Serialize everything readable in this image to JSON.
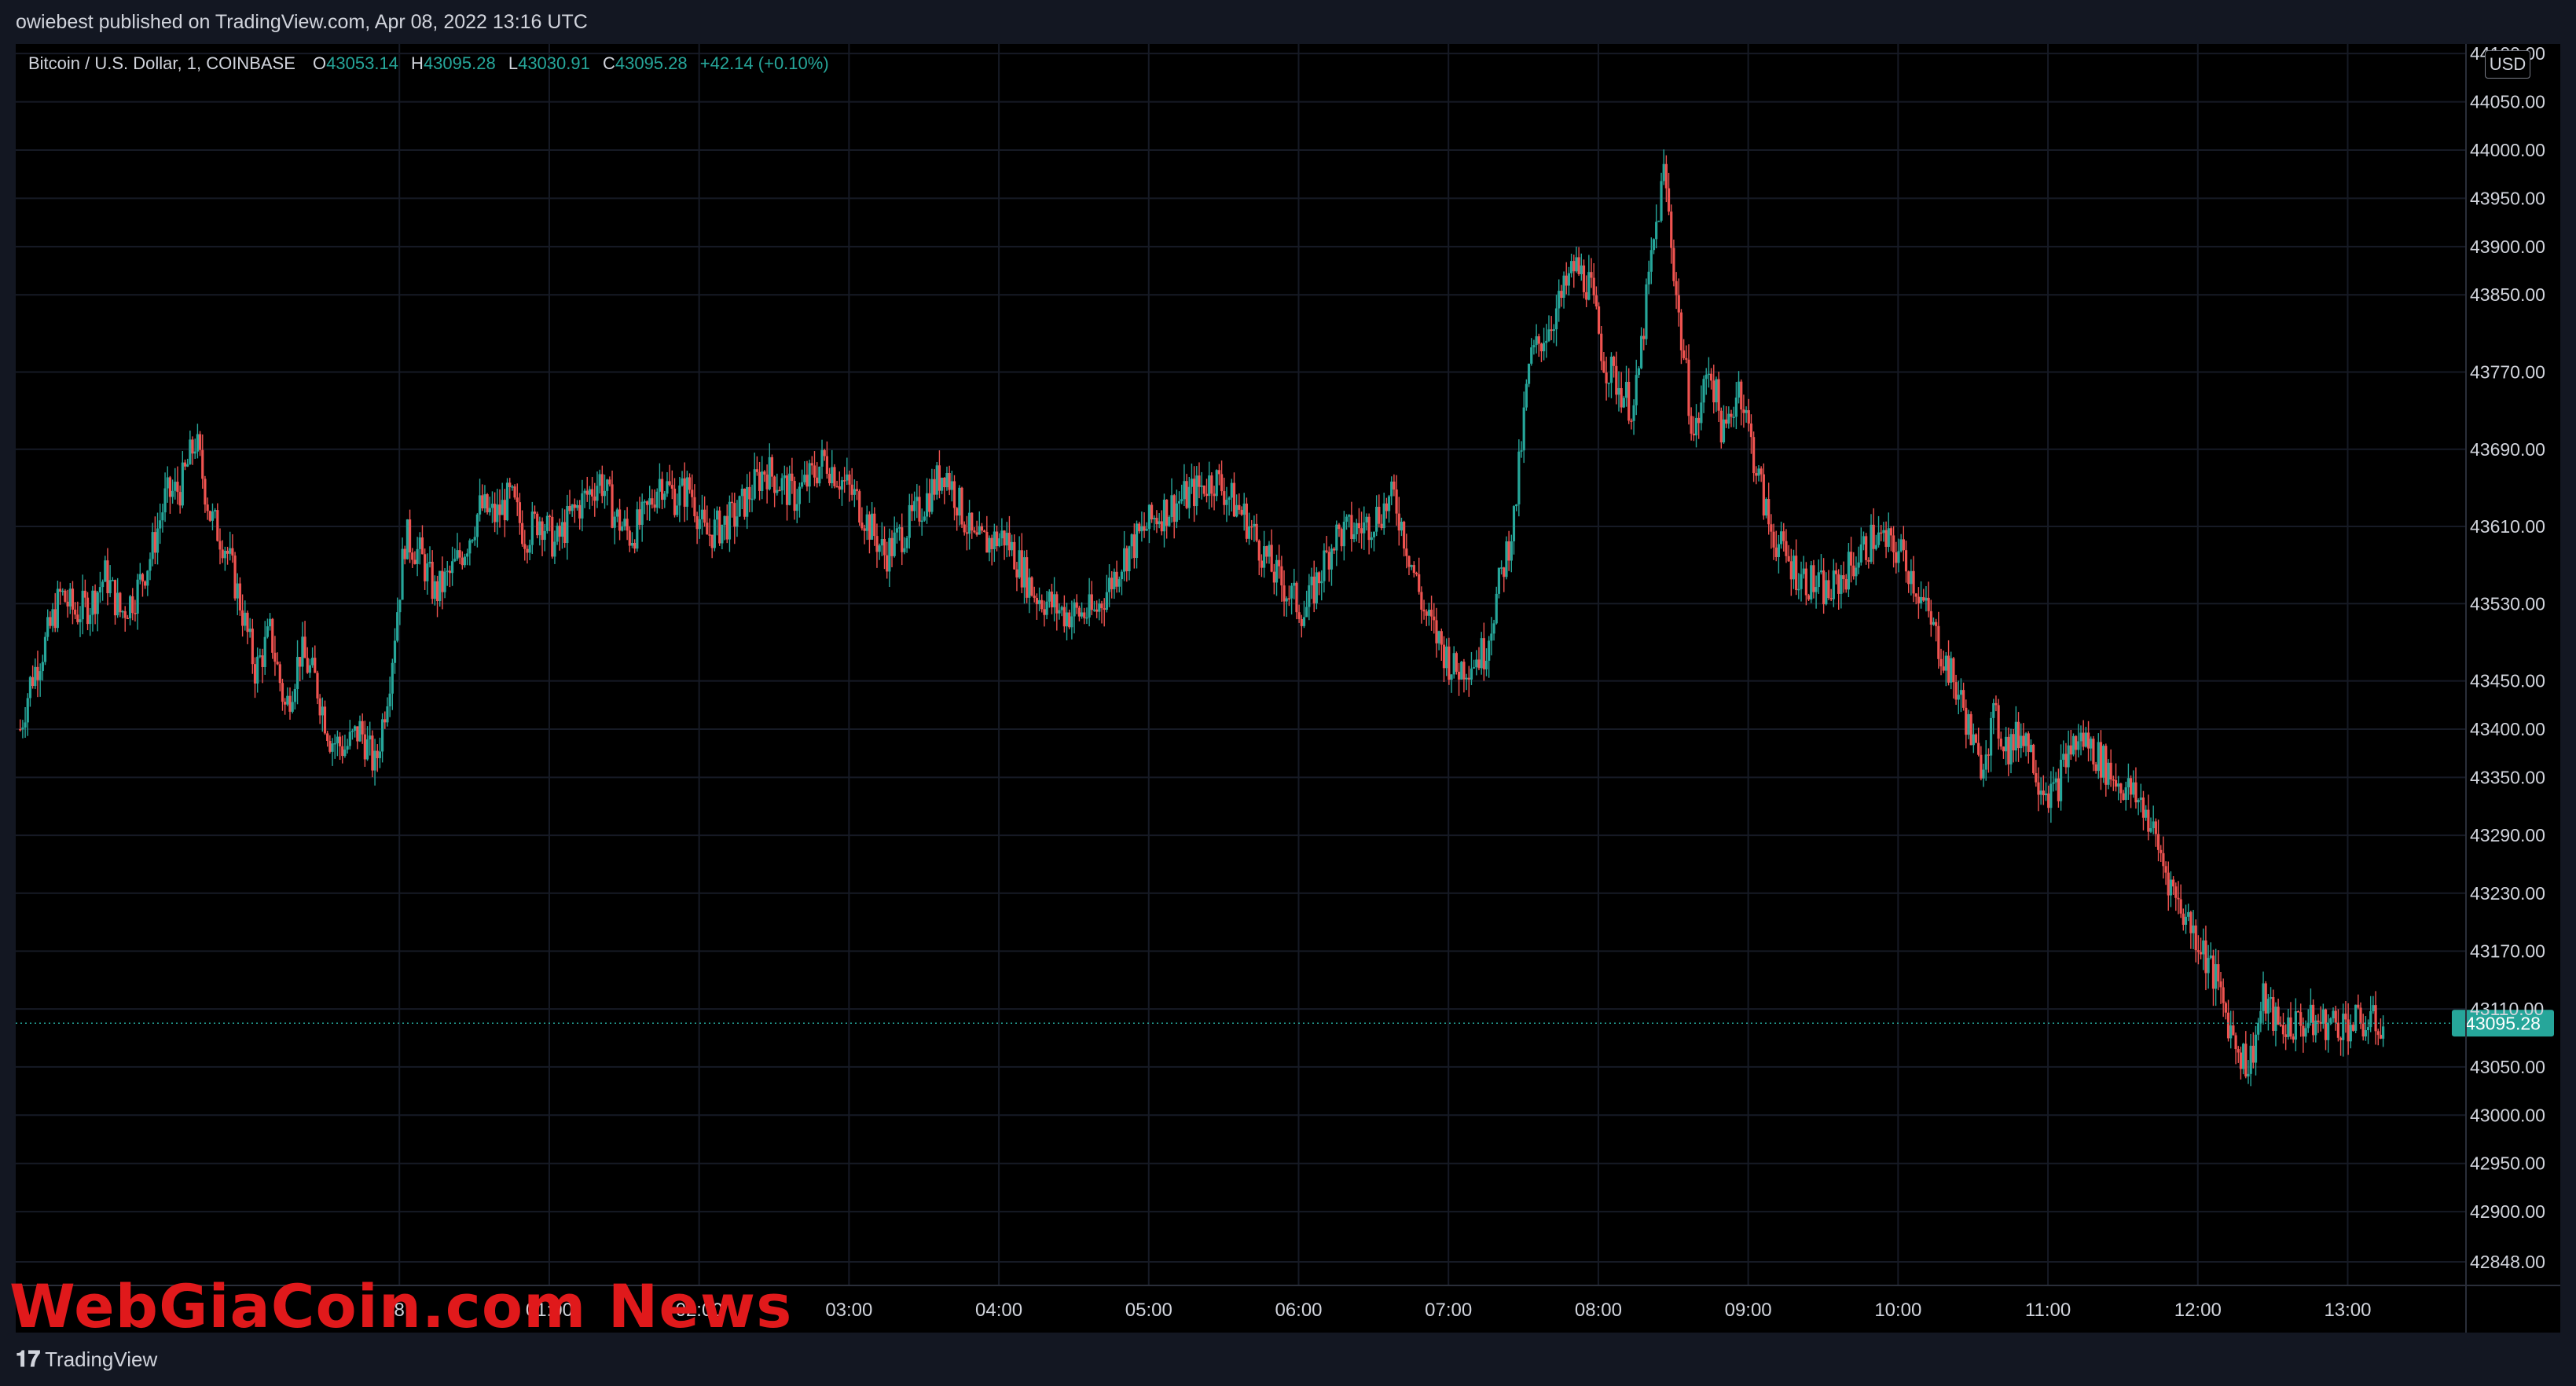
{
  "header": {
    "published_by": "owiebest published on TradingView.com, Apr 08, 2022 13:16 UTC"
  },
  "legend": {
    "symbol": "Bitcoin / U.S. Dollar, 1, COINBASE",
    "o_label": "O",
    "o_value": "43053.14",
    "h_label": "H",
    "h_value": "43095.28",
    "l_label": "L",
    "l_value": "43030.91",
    "c_label": "C",
    "c_value": "43095.28",
    "change": "+42.14 (+0.10%)"
  },
  "currency": "USD",
  "current_price_label": "43095.28",
  "footer": {
    "brand": "TradingView"
  },
  "watermark": "WebGiaCoin.com News",
  "colors": {
    "up": "#26a69a",
    "down": "#ef5350",
    "background": "#000000",
    "grid": "#161a25",
    "text": "#d1d4dc"
  },
  "chart_data": {
    "type": "line",
    "title": "Bitcoin / U.S. Dollar, 1, COINBASE",
    "ylabel": "USD",
    "ylim": [
      42800,
      44100
    ],
    "y_ticks": [
      "42848.00",
      "42900.00",
      "42950.00",
      "43000.00",
      "43050.00",
      "43110.00",
      "43170.00",
      "43230.00",
      "43290.00",
      "43350.00",
      "43400.00",
      "43450.00",
      "43530.00",
      "43610.00",
      "43690.00",
      "43770.00",
      "43850.00",
      "43900.00",
      "43950.00",
      "44000.00",
      "44050.00",
      "44100.00"
    ],
    "x_ticks": [
      "8",
      "01:00",
      "02:00",
      "03:00",
      "04:00",
      "05:00",
      "06:00",
      "07:00",
      "08:00",
      "09:00",
      "10:00",
      "11:00",
      "12:00",
      "13:00"
    ],
    "x_hours": [
      -0.04,
      0.96,
      1.96,
      2.96,
      3.96,
      4.96,
      5.96,
      6.96,
      7.96,
      8.96,
      9.96,
      10.96,
      11.96,
      12.96
    ],
    "current_price": 43095.28,
    "series": [
      {
        "x": [
          -2.57,
          -2.5,
          -2.4,
          -2.3,
          -2.2,
          -2.1,
          -2.0,
          -1.9,
          -1.8,
          -1.7,
          -1.6,
          -1.5,
          -1.4,
          -1.3,
          -1.2,
          -1.1,
          -1.0,
          -0.9,
          -0.8,
          -0.7,
          -0.6,
          -0.5,
          -0.4,
          -0.3,
          -0.2,
          -0.1,
          0.0,
          0.1,
          0.2,
          0.3,
          0.4,
          0.5,
          0.6,
          0.7,
          0.8,
          0.9,
          1.0,
          1.1,
          1.2,
          1.3,
          1.4,
          1.5,
          1.6,
          1.7,
          1.8,
          1.9,
          2.0,
          2.2,
          2.4,
          2.6,
          2.8,
          3.0,
          3.2,
          3.4,
          3.6,
          3.8,
          4.0,
          4.2,
          4.4,
          4.6,
          4.8,
          5.0,
          5.2,
          5.4,
          5.6,
          5.8,
          6.0,
          6.2,
          6.4,
          6.6,
          6.8,
          7.0,
          7.2,
          7.4,
          7.5,
          7.7,
          7.8,
          7.9,
          8.0,
          8.2,
          8.3,
          8.4,
          8.5,
          8.6,
          8.7,
          8.75,
          8.8,
          8.9,
          9.0,
          9.1,
          9.2,
          9.3,
          9.4,
          9.5,
          9.6,
          9.8,
          10.0,
          10.2,
          10.4,
          10.5,
          10.6,
          10.7,
          10.8,
          10.9,
          11.0,
          11.1,
          11.2,
          11.4,
          11.6,
          11.8,
          12.0,
          12.1,
          12.2,
          12.3,
          12.4,
          12.5,
          12.6,
          12.7,
          12.8,
          12.9,
          13.0,
          13.1,
          13.2
        ],
        "y": [
          43400,
          43450,
          43490,
          43540,
          43520,
          43530,
          43560,
          43520,
          43540,
          43580,
          43640,
          43650,
          43700,
          43620,
          43590,
          43530,
          43460,
          43500,
          43420,
          43480,
          43450,
          43390,
          43380,
          43400,
          43360,
          43460,
          43600,
          43580,
          43540,
          43560,
          43590,
          43630,
          43620,
          43640,
          43600,
          43620,
          43590,
          43620,
          43640,
          43660,
          43620,
          43600,
          43620,
          43660,
          43640,
          43650,
          43600,
          43620,
          43670,
          43640,
          43680,
          43640,
          43580,
          43620,
          43670,
          43590,
          43600,
          43540,
          43520,
          43520,
          43580,
          43620,
          43640,
          43660,
          43620,
          43560,
          43520,
          43600,
          43610,
          43640,
          43520,
          43460,
          43480,
          43620,
          43780,
          43840,
          43880,
          43860,
          43780,
          43730,
          43870,
          43980,
          43820,
          43700,
          43780,
          43740,
          43700,
          43760,
          43680,
          43610,
          43580,
          43560,
          43550,
          43540,
          43560,
          43600,
          43580,
          43500,
          43420,
          43360,
          43410,
          43380,
          43400,
          43350,
          43330,
          43380,
          43390,
          43350,
          43320,
          43230,
          43170,
          43130,
          43080,
          43050,
          43120,
          43090,
          43095,
          43095,
          43095,
          43095,
          43095,
          43095,
          43095
        ]
      }
    ]
  }
}
